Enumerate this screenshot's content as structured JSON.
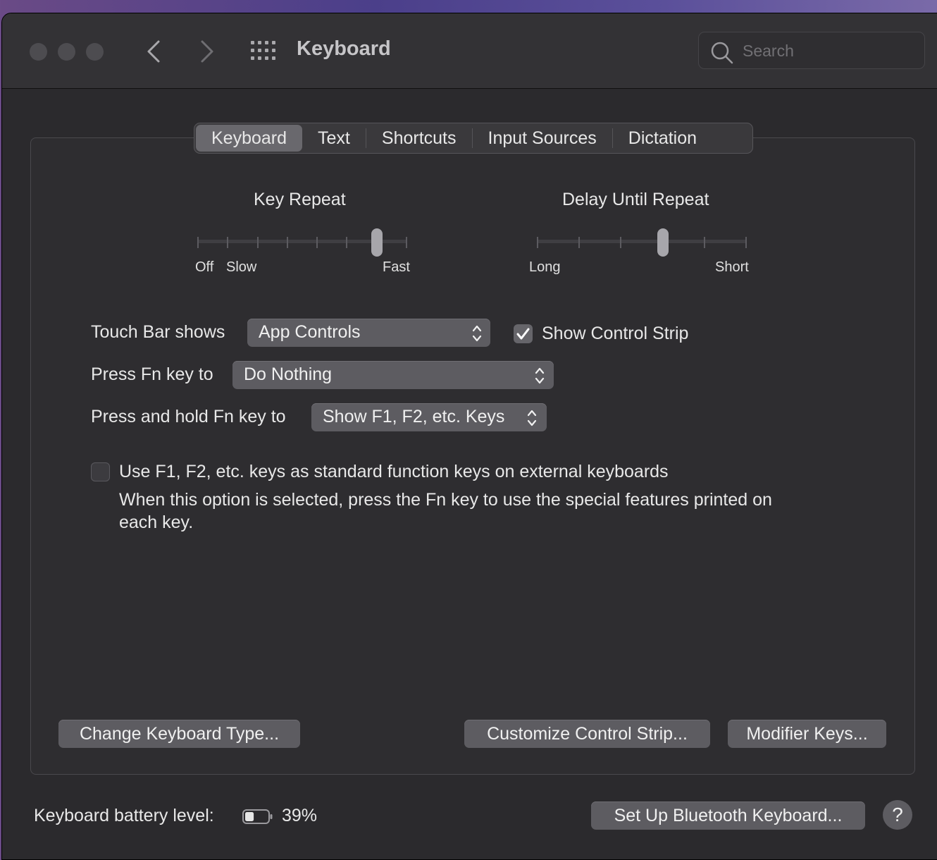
{
  "window": {
    "title": "Keyboard",
    "search_placeholder": "Search"
  },
  "tabs": [
    {
      "label": "Keyboard",
      "active": true
    },
    {
      "label": "Text",
      "active": false
    },
    {
      "label": "Shortcuts",
      "active": false
    },
    {
      "label": "Input Sources",
      "active": false
    },
    {
      "label": "Dictation",
      "active": false
    }
  ],
  "key_repeat": {
    "title": "Key Repeat",
    "labels": {
      "off": "Off",
      "slow": "Slow",
      "fast": "Fast"
    },
    "stops": 8,
    "selected_stop": 6
  },
  "delay_until_repeat": {
    "title": "Delay Until Repeat",
    "labels": {
      "long": "Long",
      "short": "Short"
    },
    "stops": 6,
    "selected_stop": 3
  },
  "settings": {
    "touch_bar_label": "Touch Bar shows",
    "touch_bar_value": "App Controls",
    "show_control_strip_label": "Show Control Strip",
    "show_control_strip_checked": true,
    "fn_label": "Press Fn key to",
    "fn_value": "Do Nothing",
    "hold_fn_label": "Press and hold Fn key to",
    "hold_fn_value": "Show F1, F2, etc. Keys",
    "function_keys_label": "Use F1, F2, etc. keys as standard function keys on external keyboards",
    "function_keys_checked": false,
    "function_keys_description_line1": "When this option is selected, press the Fn key to use the special features printed on",
    "function_keys_description_line2": "each key."
  },
  "buttons": {
    "change_keyboard_type": "Change Keyboard Type...",
    "customize_control_strip": "Customize Control Strip...",
    "modifier_keys": "Modifier Keys...",
    "setup_bluetooth": "Set Up Bluetooth Keyboard...",
    "help": "?"
  },
  "battery": {
    "label": "Keyboard battery level:",
    "percent_text": "39%",
    "level": 0.39
  },
  "colors": {
    "window_bg": "#2b2a2d",
    "control_bg": "#5d5c61",
    "text": "#e8e8e8"
  }
}
